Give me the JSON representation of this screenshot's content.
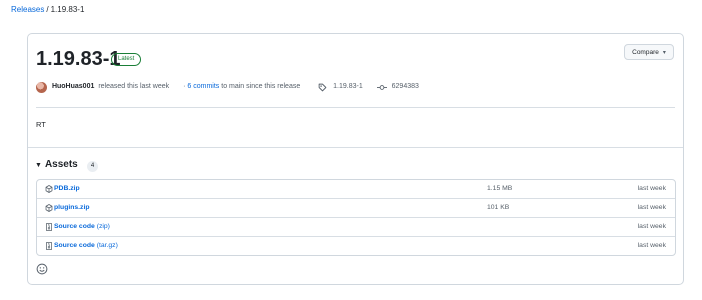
{
  "breadcrumb": {
    "parent": "Releases",
    "separator": "/",
    "current": "1.19.83-1"
  },
  "release": {
    "title": "1.19.83-1",
    "badge": "Latest",
    "compare_label": "Compare",
    "author": "HuoHuas001",
    "released_text": "released this last week",
    "commits_prefix": "·",
    "commits_link": "6 commits",
    "commits_suffix": "to main since this release",
    "tag": "1.19.83-1",
    "commit_sha": "6294383",
    "body": "RT"
  },
  "assets": {
    "heading": "Assets",
    "count": "4",
    "rows": [
      {
        "name": "PDB.zip",
        "suffix": "",
        "size": "1.15 MB",
        "date": "last week",
        "icon": "package-icon"
      },
      {
        "name": "plugins.zip",
        "suffix": "",
        "size": "101 KB",
        "date": "last week",
        "icon": "package-icon"
      },
      {
        "name": "Source code",
        "suffix": "(zip)",
        "size": "",
        "date": "last week",
        "icon": "file-zip-icon"
      },
      {
        "name": "Source code",
        "suffix": "(tar.gz)",
        "size": "",
        "date": "last week",
        "icon": "file-zip-icon"
      }
    ]
  },
  "colors": {
    "link": "#0969da",
    "badge_green": "#1a7f37",
    "border": "#d0d7de",
    "muted": "#57606a"
  }
}
